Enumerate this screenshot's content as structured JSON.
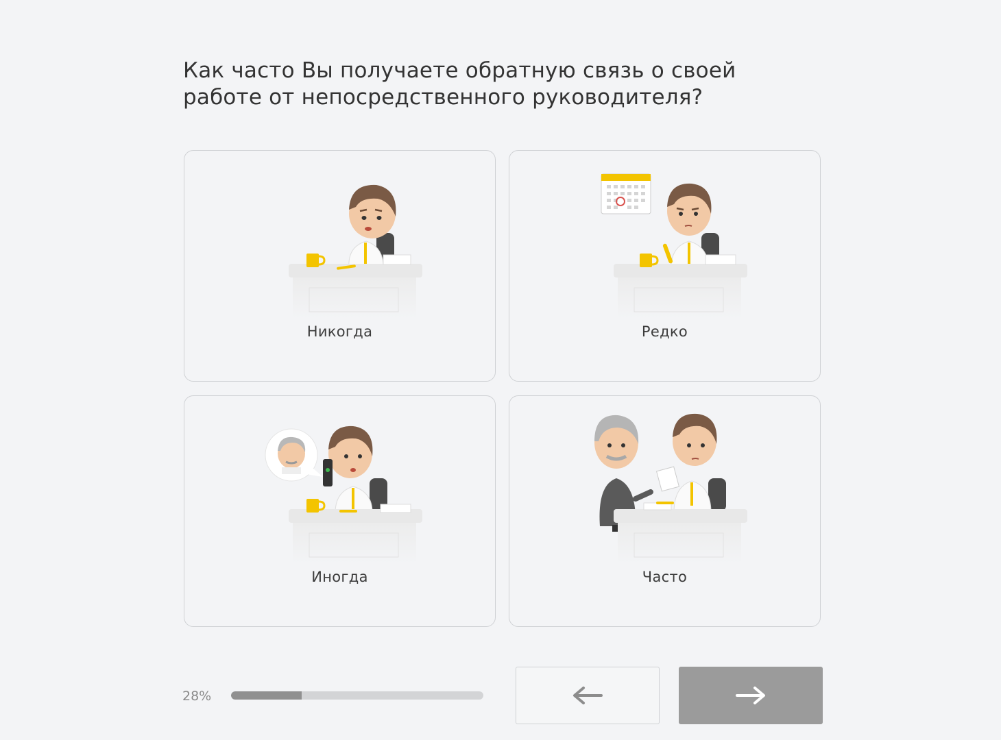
{
  "question": {
    "line1": "Как часто Вы получаете обратную связь о своей",
    "line2": "работе от непосредственного руководителя?"
  },
  "options": [
    {
      "label": "Никогда",
      "illustration": "bored-man-at-desk"
    },
    {
      "label": "Редко",
      "illustration": "man-at-desk-with-calendar"
    },
    {
      "label": "Иногда",
      "illustration": "man-on-phone-with-boss"
    },
    {
      "label": "Часто",
      "illustration": "boss-talking-to-employee"
    }
  ],
  "progress": {
    "label": "28%",
    "value": 0.28
  },
  "nav": {
    "back_icon": "arrow-left-icon",
    "next_icon": "arrow-right-icon"
  },
  "colors": {
    "accent_yellow": "#f3c400",
    "button_next": "#9b9b9b",
    "progress_fill": "#909090",
    "progress_track": "#d3d4d6"
  }
}
